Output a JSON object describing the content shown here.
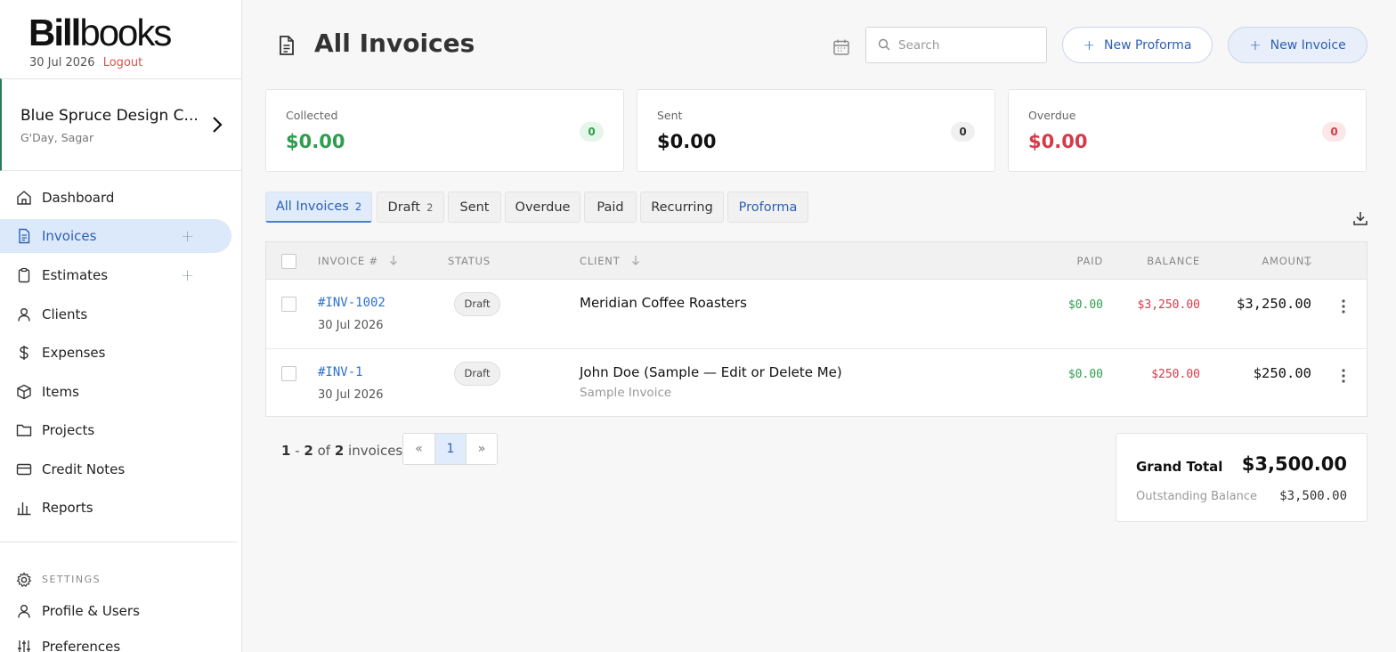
{
  "brand": {
    "logo_bold": "Bill",
    "logo_light": "books",
    "date": "30 Jul 2026",
    "logout": "Logout"
  },
  "company": {
    "name": "Blue Spruce Design C...",
    "greeting": "G'Day, Sagar"
  },
  "sidebar": {
    "items": [
      {
        "label": "Dashboard",
        "icon": "home-icon"
      },
      {
        "label": "Invoices",
        "icon": "invoice-icon",
        "active": true,
        "has_add": true
      },
      {
        "label": "Estimates",
        "icon": "clipboard-icon",
        "has_add": true
      },
      {
        "label": "Clients",
        "icon": "user-icon"
      },
      {
        "label": "Expenses",
        "icon": "dollar-icon"
      },
      {
        "label": "Items",
        "icon": "box-icon"
      },
      {
        "label": "Projects",
        "icon": "folder-icon"
      },
      {
        "label": "Credit Notes",
        "icon": "card-icon"
      },
      {
        "label": "Reports",
        "icon": "bar-chart-icon"
      }
    ],
    "settings_label": "SETTINGS",
    "settings_items": [
      {
        "label": "Profile & Users",
        "icon": "user-icon"
      },
      {
        "label": "Preferences",
        "icon": "sliders-icon"
      }
    ]
  },
  "header": {
    "title": "All Invoices",
    "search_placeholder": "Search",
    "new_proforma": "New Proforma",
    "new_invoice": "New Invoice"
  },
  "stats": {
    "collected": {
      "label": "Collected",
      "value": "$0.00",
      "count": "0"
    },
    "sent": {
      "label": "Sent",
      "value": "$0.00",
      "count": "0"
    },
    "overdue": {
      "label": "Overdue",
      "value": "$0.00",
      "count": "0"
    }
  },
  "tabs": [
    {
      "label": "All Invoices",
      "count": "2",
      "active": true
    },
    {
      "label": "Draft",
      "count": "2"
    },
    {
      "label": "Sent",
      "count": ""
    },
    {
      "label": "Overdue",
      "count": ""
    },
    {
      "label": "Paid",
      "count": ""
    },
    {
      "label": "Recurring",
      "count": ""
    },
    {
      "label": "Proforma",
      "count": ""
    }
  ],
  "table": {
    "columns": {
      "invoice": "INVOICE #",
      "status": "STATUS",
      "client": "CLIENT",
      "paid": "PAID",
      "balance": "BALANCE",
      "amount": "AMOUNT"
    },
    "rows": [
      {
        "number": "#INV-1002",
        "date": "30 Jul 2026",
        "status": "Draft",
        "client": "Meridian Coffee Roasters",
        "client_note": "",
        "paid": "$0.00",
        "balance": "$3,250.00",
        "amount": "$3,250.00"
      },
      {
        "number": "#INV-1",
        "date": "30 Jul 2026",
        "status": "Draft",
        "client": "John Doe (Sample — Edit or Delete Me)",
        "client_note": "Sample Invoice",
        "paid": "$0.00",
        "balance": "$250.00",
        "amount": "$250.00"
      }
    ]
  },
  "pagination": {
    "from": "1",
    "to": "2",
    "total": "2",
    "unit": "invoices",
    "prev": "«",
    "current": "1",
    "next": "»"
  },
  "totals": {
    "grand_total_label": "Grand Total",
    "grand_total": "$3,500.00",
    "outstanding_label": "Outstanding Balance",
    "outstanding": "$3,500.00"
  }
}
